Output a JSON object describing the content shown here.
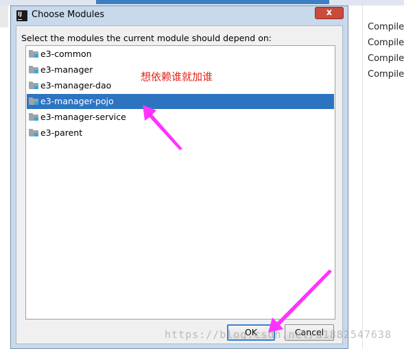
{
  "background": {
    "scopes": [
      "Compile",
      "Compile",
      "Compile",
      "Compile"
    ]
  },
  "dialog": {
    "title": "Choose Modules",
    "close_label": "x",
    "prompt": "Select the modules the current module should depend on:",
    "modules": [
      {
        "label": "e3-common",
        "selected": false
      },
      {
        "label": "e3-manager",
        "selected": false
      },
      {
        "label": "e3-manager-dao",
        "selected": false
      },
      {
        "label": "e3-manager-pojo",
        "selected": true
      },
      {
        "label": "e3-manager-service",
        "selected": false
      },
      {
        "label": "e3-parent",
        "selected": false
      }
    ],
    "ok_label": "OK",
    "cancel_label": "Cancel"
  },
  "annotation": {
    "text": "想依赖谁就加谁",
    "color": "#e2231a",
    "arrow_color": "#ff33ff"
  },
  "watermark": "https://blog.csdn.net/a1882547638"
}
